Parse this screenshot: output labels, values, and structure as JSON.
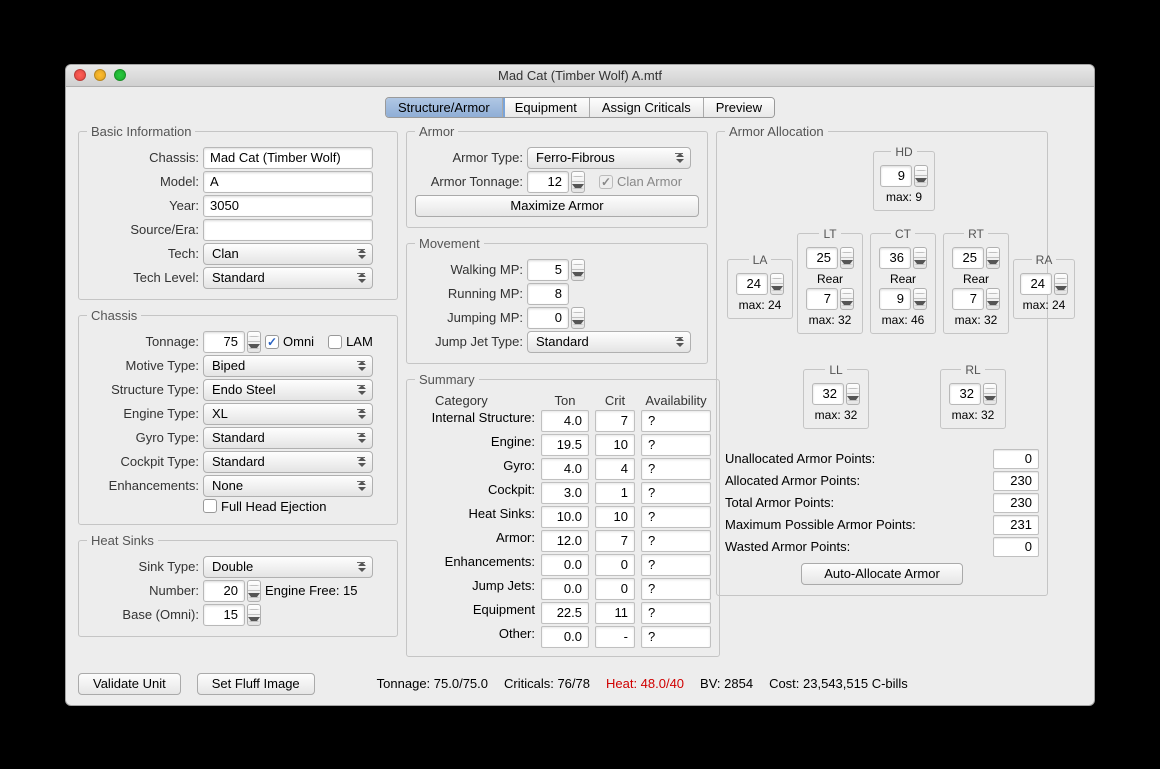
{
  "window_title": "Mad Cat (Timber Wolf) A.mtf",
  "tabs": [
    "Structure/Armor",
    "Equipment",
    "Assign Criticals",
    "Preview"
  ],
  "activeTab": 0,
  "basic": {
    "legend": "Basic Information",
    "chassis_label": "Chassis:",
    "chassis": "Mad Cat (Timber Wolf)",
    "model_label": "Model:",
    "model": "A",
    "year_label": "Year:",
    "year": "3050",
    "source_label": "Source/Era:",
    "source": "",
    "tech_label": "Tech:",
    "tech": "Clan",
    "techlevel_label": "Tech Level:",
    "techlevel": "Standard"
  },
  "chassis": {
    "legend": "Chassis",
    "tonnage_label": "Tonnage:",
    "tonnage": "75",
    "omni_label": "Omni",
    "omni": true,
    "lam_label": "LAM",
    "lam": false,
    "motive_label": "Motive Type:",
    "motive": "Biped",
    "structure_label": "Structure Type:",
    "structure": "Endo Steel",
    "engine_label": "Engine Type:",
    "engine": "XL",
    "gyro_label": "Gyro Type:",
    "gyro": "Standard",
    "cockpit_label": "Cockpit Type:",
    "cockpit": "Standard",
    "enh_label": "Enhancements:",
    "enh": "None",
    "fhe_label": "Full Head Ejection",
    "fhe": false
  },
  "heatsinks": {
    "legend": "Heat Sinks",
    "type_label": "Sink Type:",
    "type": "Double",
    "number_label": "Number:",
    "number": "20",
    "enginefree_label": "Engine Free: 15",
    "base_label": "Base (Omni):",
    "base": "15"
  },
  "armor": {
    "legend": "Armor",
    "type_label": "Armor Type:",
    "type": "Ferro-Fibrous",
    "tonnage_label": "Armor Tonnage:",
    "tonnage": "12",
    "clan_label": "Clan Armor",
    "clan": true,
    "maximize": "Maximize Armor"
  },
  "movement": {
    "legend": "Movement",
    "walk_label": "Walking MP:",
    "walk": "5",
    "run_label": "Running MP:",
    "run": "8",
    "jump_label": "Jumping MP:",
    "jump": "0",
    "jjtype_label": "Jump Jet Type:",
    "jjtype": "Standard"
  },
  "summary": {
    "legend": "Summary",
    "headers": {
      "cat": "Category",
      "ton": "Ton",
      "crit": "Crit",
      "avail": "Availability"
    },
    "rows": [
      {
        "cat": "Internal Structure:",
        "ton": "4.0",
        "crit": "7",
        "avail": "?"
      },
      {
        "cat": "Engine:",
        "ton": "19.5",
        "crit": "10",
        "avail": "?"
      },
      {
        "cat": "Gyro:",
        "ton": "4.0",
        "crit": "4",
        "avail": "?"
      },
      {
        "cat": "Cockpit:",
        "ton": "3.0",
        "crit": "1",
        "avail": "?"
      },
      {
        "cat": "Heat Sinks:",
        "ton": "10.0",
        "crit": "10",
        "avail": "?"
      },
      {
        "cat": "Armor:",
        "ton": "12.0",
        "crit": "7",
        "avail": "?"
      },
      {
        "cat": "Enhancements:",
        "ton": "0.0",
        "crit": "0",
        "avail": "?"
      },
      {
        "cat": "Jump Jets:",
        "ton": "0.0",
        "crit": "0",
        "avail": "?"
      },
      {
        "cat": "Equipment",
        "ton": "22.5",
        "crit": "11",
        "avail": "?"
      },
      {
        "cat": "Other:",
        "ton": "0.0",
        "crit": "-",
        "avail": "?"
      }
    ]
  },
  "alloc": {
    "legend": "Armor Allocation",
    "hd": {
      "name": "HD",
      "val": "9",
      "max": "max: 9"
    },
    "la": {
      "name": "LA",
      "val": "24",
      "max": "max: 24"
    },
    "lt": {
      "name": "LT",
      "val": "25",
      "rear_label": "Rear",
      "rear": "7",
      "max": "max: 32"
    },
    "ct": {
      "name": "CT",
      "val": "36",
      "rear_label": "Rear",
      "rear": "9",
      "max": "max: 46"
    },
    "rt": {
      "name": "RT",
      "val": "25",
      "rear_label": "Rear",
      "rear": "7",
      "max": "max: 32"
    },
    "ra": {
      "name": "RA",
      "val": "24",
      "max": "max: 24"
    },
    "ll": {
      "name": "LL",
      "val": "32",
      "max": "max: 32"
    },
    "rl": {
      "name": "RL",
      "val": "32",
      "max": "max: 32"
    },
    "stats": [
      {
        "label": "Unallocated Armor Points:",
        "val": "0"
      },
      {
        "label": "Allocated Armor Points:",
        "val": "230"
      },
      {
        "label": "Total Armor Points:",
        "val": "230"
      },
      {
        "label": "Maximum Possible Armor Points:",
        "val": "231"
      },
      {
        "label": "Wasted Armor Points:",
        "val": "0"
      }
    ],
    "auto": "Auto-Allocate Armor"
  },
  "footer": {
    "validate": "Validate Unit",
    "fluff": "Set Fluff Image",
    "tonnage": "Tonnage: 75.0/75.0",
    "crits": "Criticals: 76/78",
    "heat": "Heat: 48.0/40",
    "bv": "BV: 2854",
    "cost": "Cost: 23,543,515 C-bills"
  }
}
